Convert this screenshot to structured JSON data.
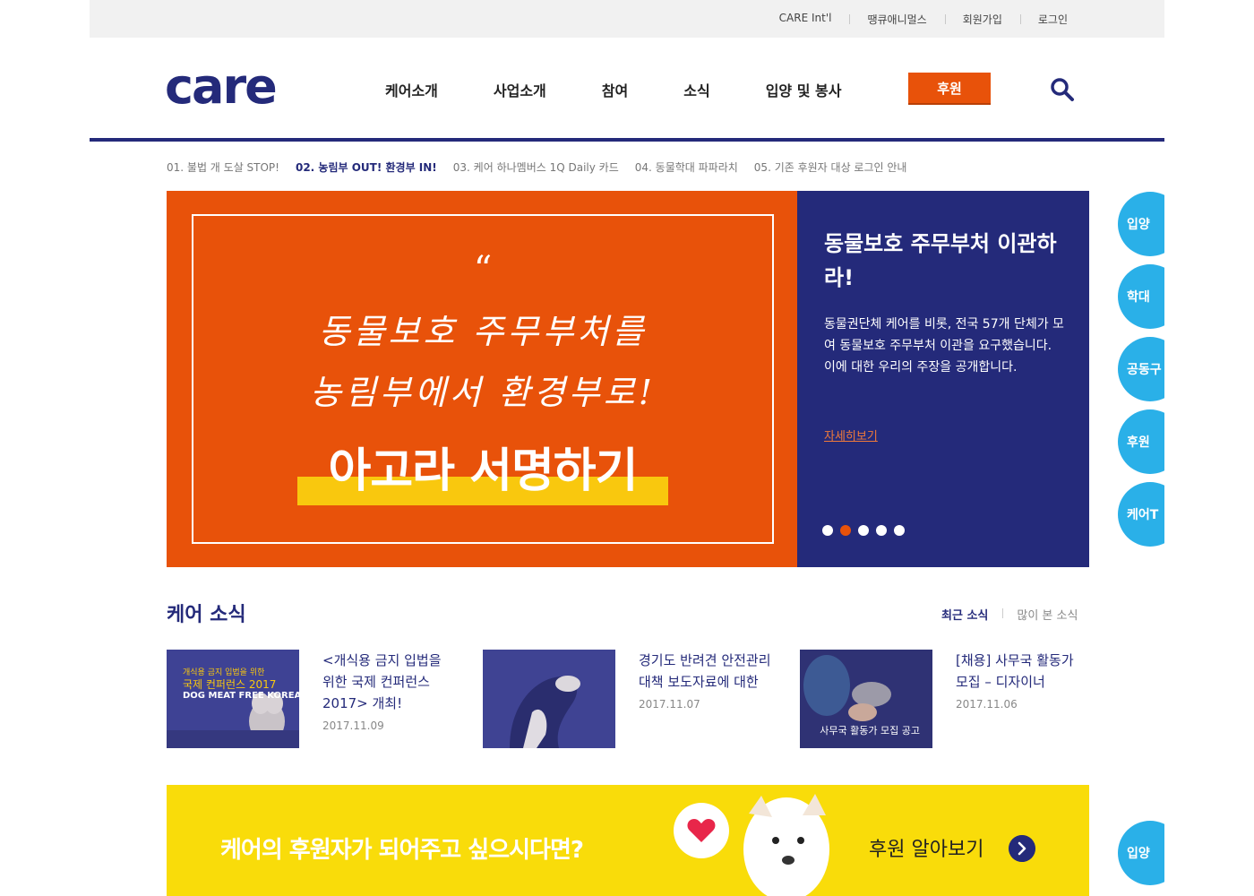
{
  "utility_nav": [
    "CARE Int'l",
    "땡큐애니멀스",
    "회원가입",
    "로그인"
  ],
  "logo_text": "care",
  "main_nav": [
    "케어소개",
    "사업소개",
    "참여",
    "소식",
    "입양 및 봉사"
  ],
  "sponsor_button": "후원",
  "slide_tabs": [
    {
      "label": "01. 불법 개 도살 STOP!",
      "active": false
    },
    {
      "label": "02. 농림부 OUT! 환경부 IN!",
      "active": true
    },
    {
      "label": "03. 케어 하나멤버스 1Q Daily 카드",
      "active": false
    },
    {
      "label": "04. 동물학대 파파라치",
      "active": false
    },
    {
      "label": "05. 기존 후원자 대상 로그인 안내",
      "active": false
    }
  ],
  "hero": {
    "quote_mark": "“",
    "hand_line1": "동물보호 주무부처를",
    "hand_line2": "농림부에서 환경부로!",
    "cta": "아고라 서명하기",
    "title": "동물보호 주무부처 이관하라!",
    "description": "동물권단체 케어를 비롯, 전국 57개 단체가 모여 동물보호 주무부처 이관을 요구했습니다. 이에 대한 우리의 주장을 공개합니다.",
    "more_link": "자세히보기",
    "active_slide": 2,
    "slide_count": 5
  },
  "side_buttons": [
    "입양",
    "학대",
    "공동구",
    "후원",
    "케어T"
  ],
  "side_button_bottom": "입양",
  "news": {
    "title": "케어 소식",
    "tabs": [
      "최근 소식",
      "많이 본 소식"
    ],
    "items": [
      {
        "headline": "<개식용 금지 입법을 위한 국제 컨퍼런스 2017> 개최!",
        "date": "2017.11.09",
        "thumb_caption_small": "개식용 금지 입법을 위한",
        "thumb_caption_main": "국제 컨퍼런스 2017",
        "thumb_caption_en": "DOG MEAT FREE KOREA"
      },
      {
        "headline": "경기도 반려견 안전관리대책 보도자료에 대한",
        "date": "2017.11.07"
      },
      {
        "headline": "[채용] 사무국 활동가 모집 – 디자이너",
        "date": "2017.11.06",
        "thumb_caption": "사무국 활동가 모집 공고"
      }
    ]
  },
  "banner": {
    "text": "케어의 후원자가 되어주고 싶으시다면?",
    "link": "후원 알아보기"
  },
  "colors": {
    "navy": "#242a7a",
    "orange": "#e8520a",
    "yellow": "#f9c80e",
    "banner_yellow": "#f9dc0a",
    "sky": "#2ab0e8"
  }
}
